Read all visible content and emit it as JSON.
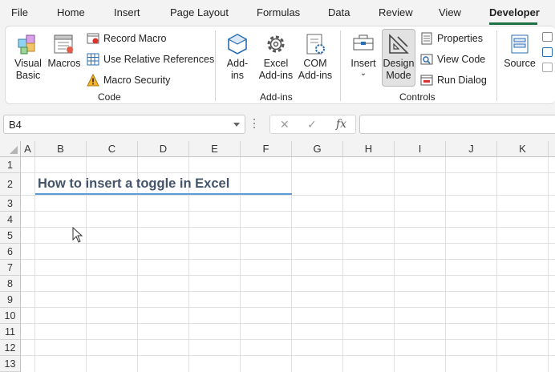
{
  "ribbon_tabs": [
    "File",
    "Home",
    "Insert",
    "Page Layout",
    "Formulas",
    "Data",
    "Review",
    "View",
    "Developer"
  ],
  "active_tab": "Developer",
  "code_group": {
    "label": "Code",
    "visual_basic": "Visual\nBasic",
    "macros": "Macros",
    "record_macro": "Record Macro",
    "use_relative": "Use Relative References",
    "macro_security": "Macro Security"
  },
  "addins_group": {
    "label": "Add-ins",
    "addins": "Add-\nins",
    "excel_addins": "Excel\nAdd-ins",
    "com_addins": "COM\nAdd-ins"
  },
  "controls_group": {
    "label": "Controls",
    "insert": "Insert",
    "design_mode": "Design\nMode",
    "properties": "Properties",
    "view_code": "View Code",
    "run_dialog": "Run Dialog"
  },
  "xml_group": {
    "source": "Source"
  },
  "formula_bar": {
    "name_box": "B4",
    "cancel_symbol": "✕",
    "enter_symbol": "✓",
    "fx_symbol": "fx",
    "formula_value": ""
  },
  "columns": [
    "A",
    "B",
    "C",
    "D",
    "E",
    "F",
    "G",
    "H",
    "I",
    "J",
    "K"
  ],
  "rows": [
    "1",
    "2",
    "3",
    "4",
    "5",
    "6",
    "7",
    "8",
    "9",
    "10",
    "11",
    "12",
    "13"
  ],
  "sheet": {
    "title": "How to insert a toggle in Excel"
  },
  "colors": {
    "accent_green": "#1e7145",
    "title_text": "#44546a",
    "title_underline": "#5b9bd5"
  }
}
